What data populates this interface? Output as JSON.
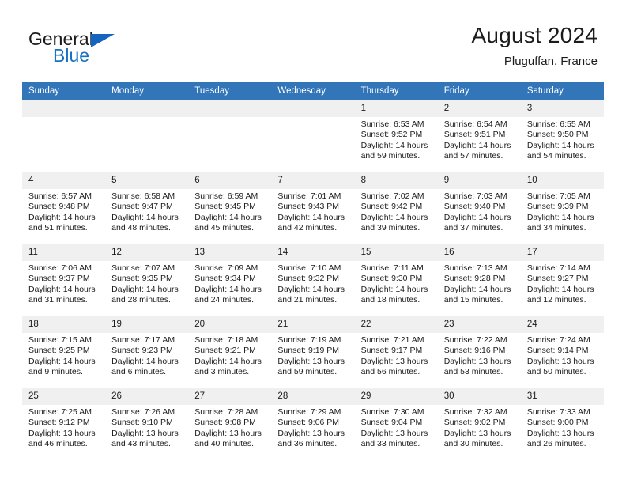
{
  "brand": {
    "word1": "General",
    "word2": "Blue",
    "triangle_color": "#1565c0",
    "word2_color": "#1572c4"
  },
  "header": {
    "title": "August 2024",
    "subtitle": "Pluguffan, France"
  },
  "theme": {
    "header_blue": "#3275b9",
    "daynum_band": "#f0f0f0",
    "text": "#1b1b1b"
  },
  "weekdays": [
    "Sunday",
    "Monday",
    "Tuesday",
    "Wednesday",
    "Thursday",
    "Friday",
    "Saturday"
  ],
  "weeks": [
    [
      {
        "day": "",
        "lines": []
      },
      {
        "day": "",
        "lines": []
      },
      {
        "day": "",
        "lines": []
      },
      {
        "day": "",
        "lines": []
      },
      {
        "day": "1",
        "lines": [
          "Sunrise: 6:53 AM",
          "Sunset: 9:52 PM",
          "Daylight: 14 hours",
          "and 59 minutes."
        ]
      },
      {
        "day": "2",
        "lines": [
          "Sunrise: 6:54 AM",
          "Sunset: 9:51 PM",
          "Daylight: 14 hours",
          "and 57 minutes."
        ]
      },
      {
        "day": "3",
        "lines": [
          "Sunrise: 6:55 AM",
          "Sunset: 9:50 PM",
          "Daylight: 14 hours",
          "and 54 minutes."
        ]
      }
    ],
    [
      {
        "day": "4",
        "lines": [
          "Sunrise: 6:57 AM",
          "Sunset: 9:48 PM",
          "Daylight: 14 hours",
          "and 51 minutes."
        ]
      },
      {
        "day": "5",
        "lines": [
          "Sunrise: 6:58 AM",
          "Sunset: 9:47 PM",
          "Daylight: 14 hours",
          "and 48 minutes."
        ]
      },
      {
        "day": "6",
        "lines": [
          "Sunrise: 6:59 AM",
          "Sunset: 9:45 PM",
          "Daylight: 14 hours",
          "and 45 minutes."
        ]
      },
      {
        "day": "7",
        "lines": [
          "Sunrise: 7:01 AM",
          "Sunset: 9:43 PM",
          "Daylight: 14 hours",
          "and 42 minutes."
        ]
      },
      {
        "day": "8",
        "lines": [
          "Sunrise: 7:02 AM",
          "Sunset: 9:42 PM",
          "Daylight: 14 hours",
          "and 39 minutes."
        ]
      },
      {
        "day": "9",
        "lines": [
          "Sunrise: 7:03 AM",
          "Sunset: 9:40 PM",
          "Daylight: 14 hours",
          "and 37 minutes."
        ]
      },
      {
        "day": "10",
        "lines": [
          "Sunrise: 7:05 AM",
          "Sunset: 9:39 PM",
          "Daylight: 14 hours",
          "and 34 minutes."
        ]
      }
    ],
    [
      {
        "day": "11",
        "lines": [
          "Sunrise: 7:06 AM",
          "Sunset: 9:37 PM",
          "Daylight: 14 hours",
          "and 31 minutes."
        ]
      },
      {
        "day": "12",
        "lines": [
          "Sunrise: 7:07 AM",
          "Sunset: 9:35 PM",
          "Daylight: 14 hours",
          "and 28 minutes."
        ]
      },
      {
        "day": "13",
        "lines": [
          "Sunrise: 7:09 AM",
          "Sunset: 9:34 PM",
          "Daylight: 14 hours",
          "and 24 minutes."
        ]
      },
      {
        "day": "14",
        "lines": [
          "Sunrise: 7:10 AM",
          "Sunset: 9:32 PM",
          "Daylight: 14 hours",
          "and 21 minutes."
        ]
      },
      {
        "day": "15",
        "lines": [
          "Sunrise: 7:11 AM",
          "Sunset: 9:30 PM",
          "Daylight: 14 hours",
          "and 18 minutes."
        ]
      },
      {
        "day": "16",
        "lines": [
          "Sunrise: 7:13 AM",
          "Sunset: 9:28 PM",
          "Daylight: 14 hours",
          "and 15 minutes."
        ]
      },
      {
        "day": "17",
        "lines": [
          "Sunrise: 7:14 AM",
          "Sunset: 9:27 PM",
          "Daylight: 14 hours",
          "and 12 minutes."
        ]
      }
    ],
    [
      {
        "day": "18",
        "lines": [
          "Sunrise: 7:15 AM",
          "Sunset: 9:25 PM",
          "Daylight: 14 hours",
          "and 9 minutes."
        ]
      },
      {
        "day": "19",
        "lines": [
          "Sunrise: 7:17 AM",
          "Sunset: 9:23 PM",
          "Daylight: 14 hours",
          "and 6 minutes."
        ]
      },
      {
        "day": "20",
        "lines": [
          "Sunrise: 7:18 AM",
          "Sunset: 9:21 PM",
          "Daylight: 14 hours",
          "and 3 minutes."
        ]
      },
      {
        "day": "21",
        "lines": [
          "Sunrise: 7:19 AM",
          "Sunset: 9:19 PM",
          "Daylight: 13 hours",
          "and 59 minutes."
        ]
      },
      {
        "day": "22",
        "lines": [
          "Sunrise: 7:21 AM",
          "Sunset: 9:17 PM",
          "Daylight: 13 hours",
          "and 56 minutes."
        ]
      },
      {
        "day": "23",
        "lines": [
          "Sunrise: 7:22 AM",
          "Sunset: 9:16 PM",
          "Daylight: 13 hours",
          "and 53 minutes."
        ]
      },
      {
        "day": "24",
        "lines": [
          "Sunrise: 7:24 AM",
          "Sunset: 9:14 PM",
          "Daylight: 13 hours",
          "and 50 minutes."
        ]
      }
    ],
    [
      {
        "day": "25",
        "lines": [
          "Sunrise: 7:25 AM",
          "Sunset: 9:12 PM",
          "Daylight: 13 hours",
          "and 46 minutes."
        ]
      },
      {
        "day": "26",
        "lines": [
          "Sunrise: 7:26 AM",
          "Sunset: 9:10 PM",
          "Daylight: 13 hours",
          "and 43 minutes."
        ]
      },
      {
        "day": "27",
        "lines": [
          "Sunrise: 7:28 AM",
          "Sunset: 9:08 PM",
          "Daylight: 13 hours",
          "and 40 minutes."
        ]
      },
      {
        "day": "28",
        "lines": [
          "Sunrise: 7:29 AM",
          "Sunset: 9:06 PM",
          "Daylight: 13 hours",
          "and 36 minutes."
        ]
      },
      {
        "day": "29",
        "lines": [
          "Sunrise: 7:30 AM",
          "Sunset: 9:04 PM",
          "Daylight: 13 hours",
          "and 33 minutes."
        ]
      },
      {
        "day": "30",
        "lines": [
          "Sunrise: 7:32 AM",
          "Sunset: 9:02 PM",
          "Daylight: 13 hours",
          "and 30 minutes."
        ]
      },
      {
        "day": "31",
        "lines": [
          "Sunrise: 7:33 AM",
          "Sunset: 9:00 PM",
          "Daylight: 13 hours",
          "and 26 minutes."
        ]
      }
    ]
  ]
}
